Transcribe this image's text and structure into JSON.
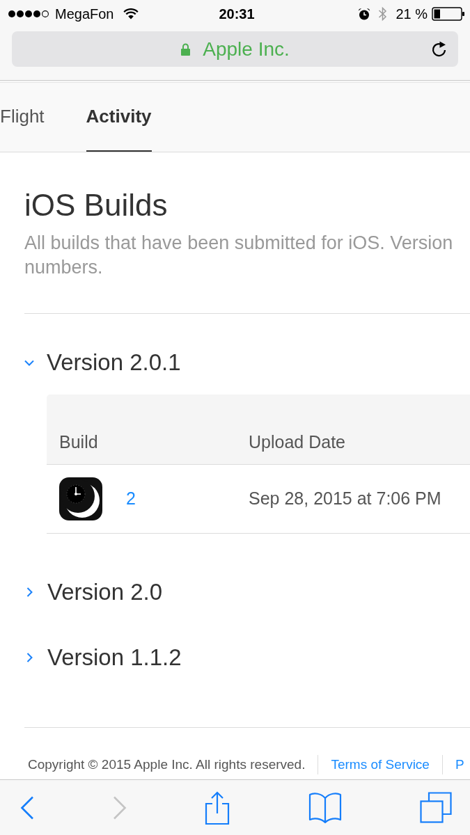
{
  "status_bar": {
    "carrier": "MegaFon",
    "time": "20:31",
    "battery": "21 %"
  },
  "address_bar": {
    "title": "Apple Inc."
  },
  "tabs": [
    {
      "label": "Flight",
      "selected": false
    },
    {
      "label": "Activity",
      "selected": true
    }
  ],
  "page": {
    "title": "iOS Builds",
    "description": "All builds that have been submitted for iOS. Version numbers."
  },
  "versions": [
    {
      "label": "Version 2.0.1",
      "expanded": true,
      "table": {
        "columns": [
          "Build",
          "Upload Date"
        ],
        "rows": [
          {
            "build": "2",
            "upload_date": "Sep 28, 2015 at 7:06 PM"
          }
        ]
      }
    },
    {
      "label": "Version 2.0",
      "expanded": false
    },
    {
      "label": "Version 1.1.2",
      "expanded": false
    }
  ],
  "footer": {
    "copyright": "Copyright © 2015 Apple Inc. All rights reserved.",
    "links": [
      "Terms of Service",
      "P"
    ]
  },
  "toolbar": {
    "buttons": [
      {
        "kind": "back",
        "disabled": false
      },
      {
        "kind": "forward",
        "disabled": true
      },
      {
        "kind": "share",
        "disabled": false
      },
      {
        "kind": "bookmarks",
        "disabled": false
      },
      {
        "kind": "tabs",
        "disabled": false
      }
    ]
  }
}
